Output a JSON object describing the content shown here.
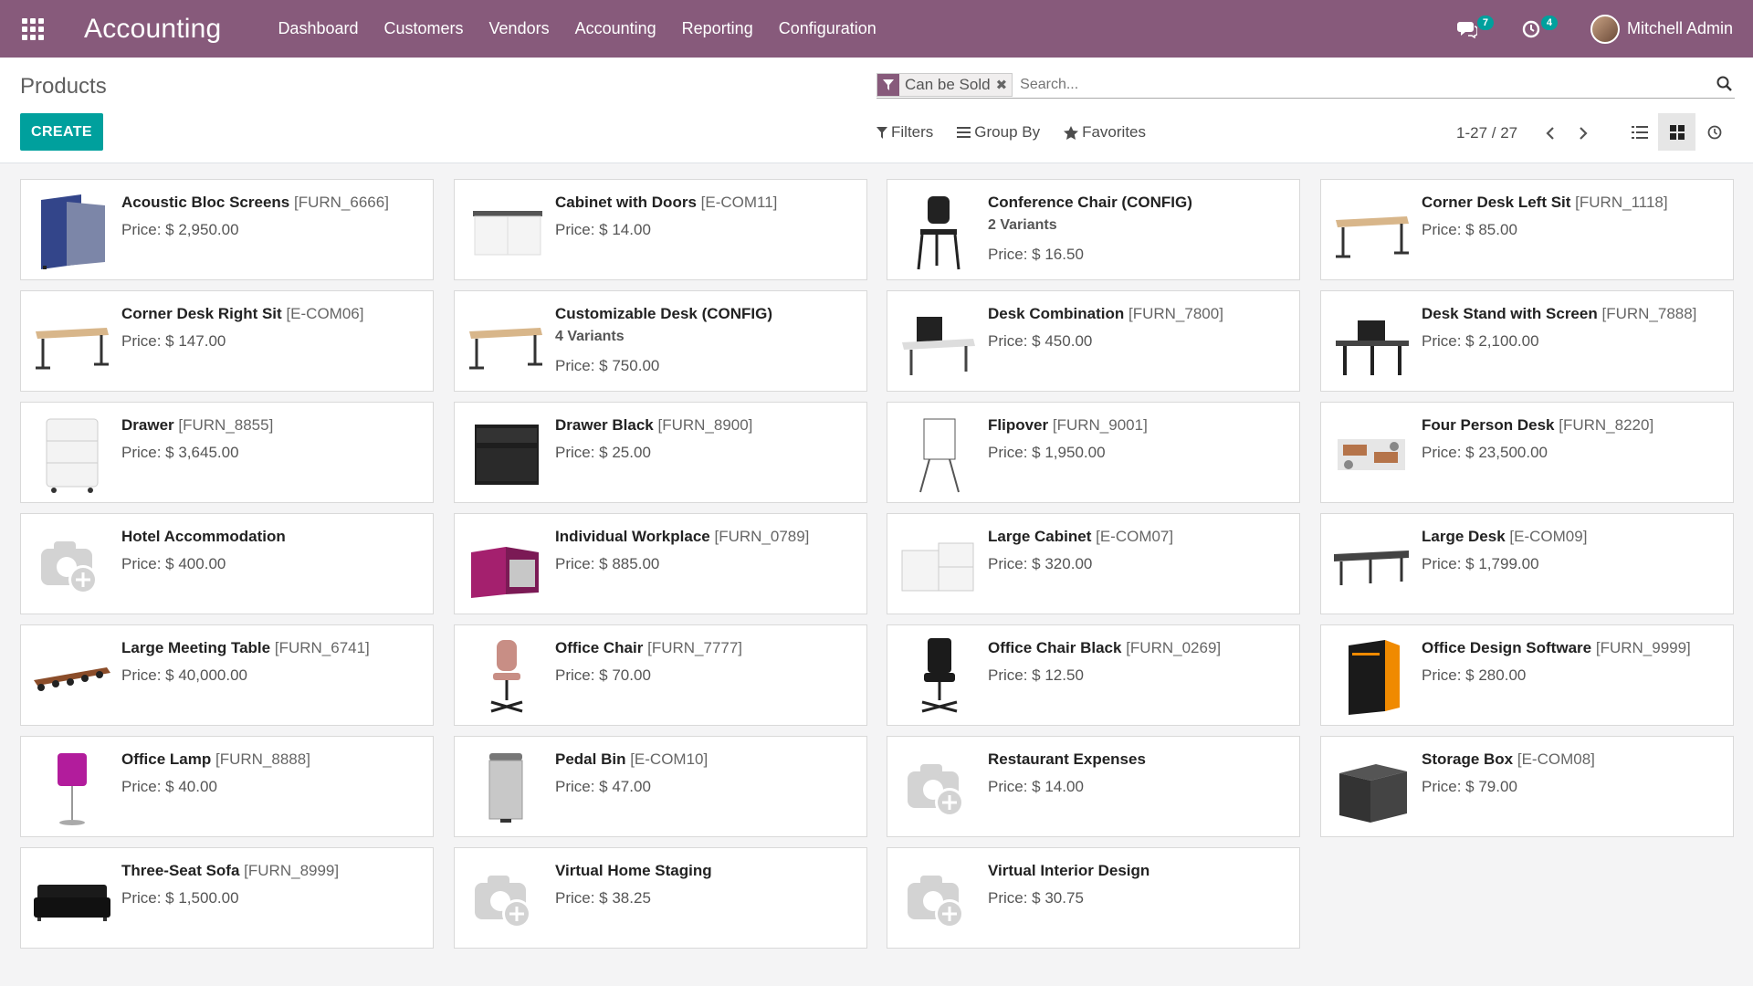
{
  "navbar": {
    "brand": "Accounting",
    "menu": [
      "Dashboard",
      "Customers",
      "Vendors",
      "Accounting",
      "Reporting",
      "Configuration"
    ],
    "messages_count": "7",
    "activities_count": "4",
    "user": "Mitchell Admin",
    "color": "#875a7b"
  },
  "control": {
    "breadcrumb": "Products",
    "create_label": "CREATE",
    "facet": "Can be Sold",
    "search_placeholder": "Search...",
    "filters": "Filters",
    "group_by": "Group By",
    "favorites": "Favorites",
    "pager": "1-27 / 27",
    "accent": "#00a09d"
  },
  "products": [
    {
      "name": "Acoustic Bloc Screens",
      "code": "[FURN_6666]",
      "price": "Price: $ 2,950.00",
      "icon": "acoustic-screen-image"
    },
    {
      "name": "Cabinet with Doors",
      "code": "[E-COM11]",
      "price": "Price: $ 14.00",
      "icon": "cabinet-image"
    },
    {
      "name": "Conference Chair (CONFIG)",
      "code": "",
      "variants": "2 Variants",
      "price": "Price: $ 16.50",
      "icon": "chair-image"
    },
    {
      "name": "Corner Desk Left Sit",
      "code": "[FURN_1118]",
      "price": "Price: $ 85.00",
      "icon": "desk-image"
    },
    {
      "name": "Corner Desk Right Sit",
      "code": "[E-COM06]",
      "price": "Price: $ 147.00",
      "icon": "desk-image"
    },
    {
      "name": "Customizable Desk (CONFIG)",
      "code": "",
      "variants": "4 Variants",
      "price": "Price: $ 750.00",
      "icon": "desk-image"
    },
    {
      "name": "Desk Combination",
      "code": "[FURN_7800]",
      "price": "Price: $ 450.00",
      "icon": "desk-combination-image"
    },
    {
      "name": "Desk Stand with Screen",
      "code": "[FURN_7888]",
      "price": "Price: $ 2,100.00",
      "icon": "desk-stand-image"
    },
    {
      "name": "Drawer",
      "code": "[FURN_8855]",
      "price": "Price: $ 3,645.00",
      "icon": "drawer-image"
    },
    {
      "name": "Drawer Black",
      "code": "[FURN_8900]",
      "price": "Price: $ 25.00",
      "icon": "drawer-black-image"
    },
    {
      "name": "Flipover",
      "code": "[FURN_9001]",
      "price": "Price: $ 1,950.00",
      "icon": "flipover-image"
    },
    {
      "name": "Four Person Desk",
      "code": "[FURN_8220]",
      "price": "Price: $ 23,500.00",
      "icon": "four-person-desk-image"
    },
    {
      "name": "Hotel Accommodation",
      "code": "",
      "price": "Price: $ 400.00",
      "icon": "placeholder-camera-image"
    },
    {
      "name": "Individual Workplace",
      "code": "[FURN_0789]",
      "price": "Price: $ 885.00",
      "icon": "workplace-image"
    },
    {
      "name": "Large Cabinet",
      "code": "[E-COM07]",
      "price": "Price: $ 320.00",
      "icon": "large-cabinet-image"
    },
    {
      "name": "Large Desk",
      "code": "[E-COM09]",
      "price": "Price: $ 1,799.00",
      "icon": "large-desk-image"
    },
    {
      "name": "Large Meeting Table",
      "code": "[FURN_6741]",
      "price": "Price: $ 40,000.00",
      "icon": "meeting-table-image"
    },
    {
      "name": "Office Chair",
      "code": "[FURN_7777]",
      "price": "Price: $ 70.00",
      "icon": "office-chair-pink-image"
    },
    {
      "name": "Office Chair Black",
      "code": "[FURN_0269]",
      "price": "Price: $ 12.50",
      "icon": "office-chair-black-image"
    },
    {
      "name": "Office Design Software",
      "code": "[FURN_9999]",
      "price": "Price: $ 280.00",
      "icon": "software-box-image"
    },
    {
      "name": "Office Lamp",
      "code": "[FURN_8888]",
      "price": "Price: $ 40.00",
      "icon": "lamp-image"
    },
    {
      "name": "Pedal Bin",
      "code": "[E-COM10]",
      "price": "Price: $ 47.00",
      "icon": "pedal-bin-image"
    },
    {
      "name": "Restaurant Expenses",
      "code": "",
      "price": "Price: $ 14.00",
      "icon": "placeholder-camera-image"
    },
    {
      "name": "Storage Box",
      "code": "[E-COM08]",
      "price": "Price: $ 79.00",
      "icon": "storage-box-image"
    },
    {
      "name": "Three-Seat Sofa",
      "code": "[FURN_8999]",
      "price": "Price: $ 1,500.00",
      "icon": "sofa-image"
    },
    {
      "name": "Virtual Home Staging",
      "code": "",
      "price": "Price: $ 38.25",
      "icon": "placeholder-camera-image"
    },
    {
      "name": "Virtual Interior Design",
      "code": "",
      "price": "Price: $ 30.75",
      "icon": "placeholder-camera-image"
    }
  ]
}
